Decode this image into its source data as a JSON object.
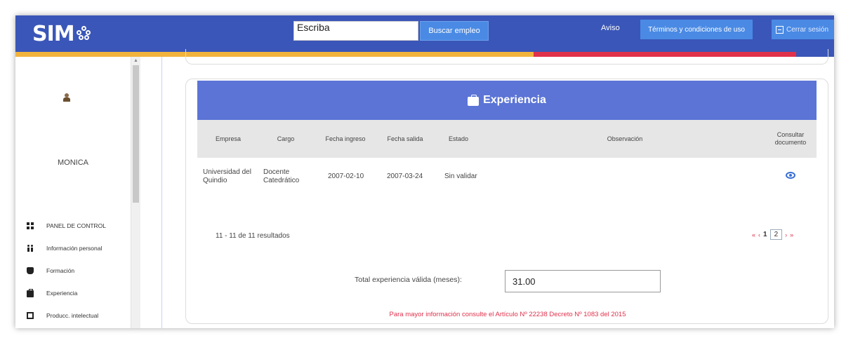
{
  "header": {
    "logo": "SIM",
    "search_value": "Escriba",
    "search_button": "Buscar empleo",
    "aviso": "Aviso",
    "terminos": "Términos y condiciones de uso",
    "cerrar": "Cerrar sesión"
  },
  "sidebar": {
    "username": "MONICA",
    "items": [
      {
        "label": "PANEL DE CONTROL",
        "icon": "dashboard-icon"
      },
      {
        "label": "Información personal",
        "icon": "person-icon"
      },
      {
        "label": "Formación",
        "icon": "graduation-cap-icon"
      },
      {
        "label": "Experiencia",
        "icon": "briefcase-icon"
      },
      {
        "label": "Producc. intelectual",
        "icon": "book-icon"
      }
    ]
  },
  "card": {
    "title": "Experiencia",
    "columns": [
      "Empresa",
      "Cargo",
      "Fecha ingreso",
      "Fecha salida",
      "Estado",
      "Observación",
      "Consultar documento"
    ],
    "rows": [
      {
        "empresa": "Universidad del Quindio",
        "cargo": "Docente Catedrático",
        "fecha_ingreso": "2007-02-10",
        "fecha_salida": "2007-03-24",
        "estado": "Sin validar",
        "observacion": ""
      }
    ],
    "results": "11 - 11 de 11 resultados",
    "pager": {
      "first": "«",
      "prev": "‹",
      "page1": "1",
      "page2": "2",
      "next": "›",
      "last": "»"
    },
    "total_label": "Total experiencia válida (meses):",
    "total_value": "31.00",
    "footnote": "Para mayor información consulte el Artículo Nº 22238 Decreto Nº 1083 del 2015"
  },
  "colors": {
    "header": "#3a56b8",
    "card_header": "#5b74d6",
    "accent_red": "#e0314b",
    "accent_yellow": "#f2b33d"
  }
}
